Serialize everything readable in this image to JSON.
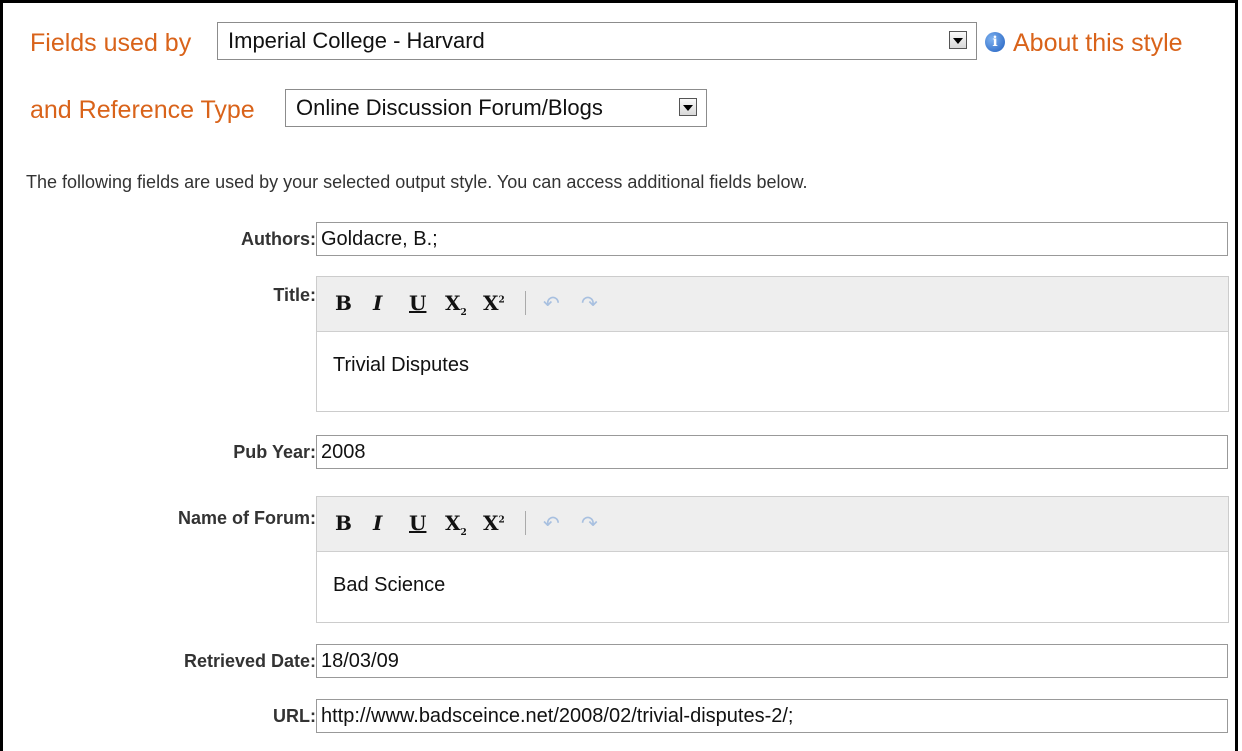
{
  "header": {
    "fields_used_by_label": "Fields used by",
    "style_select_value": "Imperial College - Harvard",
    "about_style_link": "About this style",
    "reference_type_label": "and Reference Type",
    "reference_type_value": "Online Discussion Forum/Blogs"
  },
  "intro_text": "The following fields are used by your selected output style. You can access additional fields below.",
  "toolbar": {
    "bold": "B",
    "italic": "I",
    "underline": "U",
    "subscript_base": "X",
    "subscript_mark": "2",
    "superscript_base": "X",
    "superscript_mark": "2",
    "undo": "↶",
    "redo": "↷"
  },
  "fields": {
    "authors": {
      "label": "Authors:",
      "value": "Goldacre, B.;"
    },
    "title": {
      "label": "Title:",
      "value": "Trivial Disputes"
    },
    "pub_year": {
      "label": "Pub Year:",
      "value": "2008"
    },
    "forum": {
      "label": "Name of Forum:",
      "value": "Bad Science"
    },
    "retrieved_date": {
      "label": "Retrieved Date:",
      "value": "18/03/09"
    },
    "url": {
      "label": "URL:",
      "value": "http://www.badsceince.net/2008/02/trivial-disputes-2/;"
    }
  },
  "colors": {
    "accent": "#d9631a",
    "toolbar_bg": "#eeeeee",
    "info_icon": "#1f5fbf"
  },
  "icons": [
    "info-icon",
    "dropdown-arrow-icon",
    "bold-icon",
    "italic-icon",
    "underline-icon",
    "subscript-icon",
    "superscript-icon",
    "undo-icon",
    "redo-icon"
  ]
}
